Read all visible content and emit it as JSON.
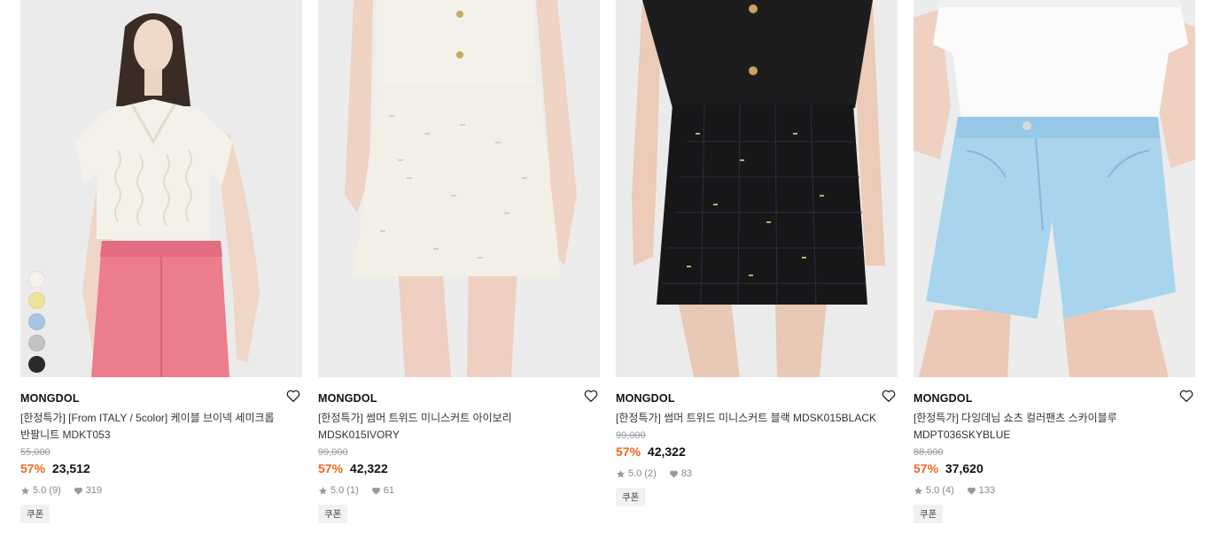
{
  "products": [
    {
      "brand": "MONGDOL",
      "name": "[한정특가] [From ITALY / 5color] 케이블 브이넥 세미크롭 반팔니트 MDKT053",
      "original_price": "55,000",
      "discount": "57%",
      "price": "23,512",
      "rating": "5.0",
      "review_count": "(9)",
      "likes": "319",
      "badge": "쿠폰",
      "swatches": [
        "#f4f2ea",
        "#eee39a",
        "#a9c5e6",
        "#c3c3c3",
        "#2a2a2a"
      ]
    },
    {
      "brand": "MONGDOL",
      "name": "[한정특가] 썸머 트위드 미니스커트 아이보리 MDSK015IVORY",
      "original_price": "99,000",
      "discount": "57%",
      "price": "42,322",
      "rating": "5.0",
      "review_count": "(1)",
      "likes": "61",
      "badge": "쿠폰"
    },
    {
      "brand": "MONGDOL",
      "name": "[한정특가] 썸머 트위드 미니스커트 블랙 MDSK015BLACK",
      "original_price": "99,000",
      "discount": "57%",
      "price": "42,322",
      "rating": "5.0",
      "review_count": "(2)",
      "likes": "83",
      "badge": "쿠폰"
    },
    {
      "brand": "MONGDOL",
      "name": "[한정특가] 다잉데님 쇼츠 컬러팬츠 스카이블루 MDPT036SKYBLUE",
      "original_price": "88,000",
      "discount": "57%",
      "price": "37,620",
      "rating": "5.0",
      "review_count": "(4)",
      "likes": "133",
      "badge": "쿠폰"
    }
  ],
  "colors": {
    "discount": "#f26522",
    "icon_gray": "#999999"
  }
}
